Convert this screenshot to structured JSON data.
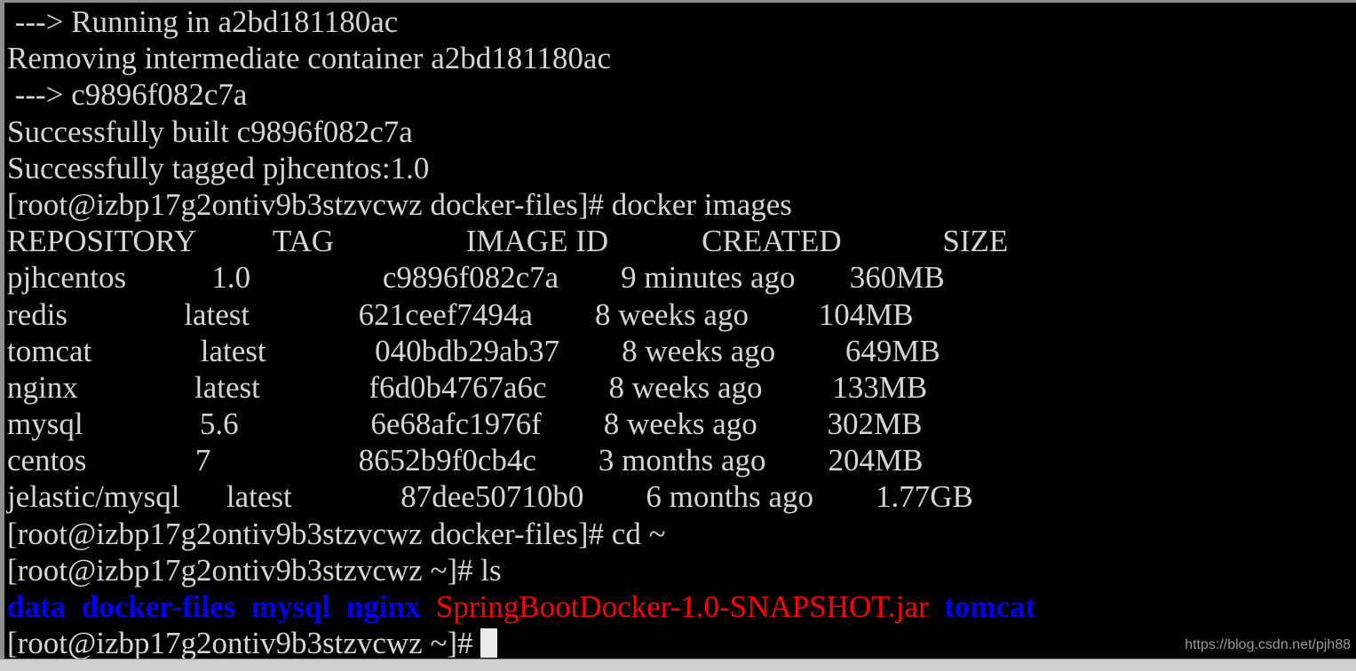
{
  "terminal": {
    "background_color": "#000000",
    "text_color": "#d3d7cf",
    "dir_color": "#0000ee",
    "archive_color": "#ff0000",
    "prompt": "[root@izbp17g2ontiv9b3stzvcwz docker-files]#",
    "prompt_home": "[root@izbp17g2ontiv9b3stzvcwz ~]#",
    "hostname": "izbp17g2ontiv9b3stzvcwz",
    "user": "root",
    "lines": {
      "l1": " ---> Running in a2bd181180ac",
      "l2": "Removing intermediate container a2bd181180ac",
      "l3": " ---> c9896f082c7a",
      "l4": "Successfully built c9896f082c7a",
      "l5": "Successfully tagged pjhcentos:1.0",
      "l6": "[root@izbp17g2ontiv9b3stzvcwz docker-files]# docker images",
      "l7": "REPOSITORY          TAG                 IMAGE ID            CREATED             SIZE",
      "l8": "pjhcentos           1.0                 c9896f082c7a        9 minutes ago       360MB",
      "l9": "redis               latest              621ceef7494a        8 weeks ago         104MB",
      "l10": "tomcat              latest              040bdb29ab37        8 weeks ago         649MB",
      "l11": "nginx               latest              f6d0b4767a6c        8 weeks ago         133MB",
      "l12": "mysql               5.6                 6e68afc1976f        8 weeks ago         302MB",
      "l13": "centos              7                   8652b9f0cb4c        3 months ago        204MB",
      "l14": "jelastic/mysql      latest              87dee50710b0        6 months ago        1.77GB",
      "l15": "[root@izbp17g2ontiv9b3stzvcwz docker-files]# cd ~",
      "l16": "[root@izbp17g2ontiv9b3stzvcwz ~]# ls",
      "l18": "[root@izbp17g2ontiv9b3stzvcwz ~]# "
    },
    "commands": {
      "docker_images": "docker images",
      "cd_home": "cd ~",
      "ls": "ls"
    },
    "table": {
      "headers": [
        "REPOSITORY",
        "TAG",
        "IMAGE ID",
        "CREATED",
        "SIZE"
      ],
      "rows": [
        {
          "repository": "pjhcentos",
          "tag": "1.0",
          "image_id": "c9896f082c7a",
          "created": "9 minutes ago",
          "size": "360MB"
        },
        {
          "repository": "redis",
          "tag": "latest",
          "image_id": "621ceef7494a",
          "created": "8 weeks ago",
          "size": "104MB"
        },
        {
          "repository": "tomcat",
          "tag": "latest",
          "image_id": "040bdb29ab37",
          "created": "8 weeks ago",
          "size": "649MB"
        },
        {
          "repository": "nginx",
          "tag": "latest",
          "image_id": "f6d0b4767a6c",
          "created": "8 weeks ago",
          "size": "133MB"
        },
        {
          "repository": "mysql",
          "tag": "5.6",
          "image_id": "6e68afc1976f",
          "created": "8 weeks ago",
          "size": "302MB"
        },
        {
          "repository": "centos",
          "tag": "7",
          "image_id": "8652b9f0cb4c",
          "created": "3 months ago",
          "size": "204MB"
        },
        {
          "repository": "jelastic/mysql",
          "tag": "latest",
          "image_id": "87dee50710b0",
          "created": "6 months ago",
          "size": "1.77GB"
        }
      ]
    },
    "ls_output": {
      "i0": "data",
      "sp0": "  ",
      "i1": "docker-files",
      "sp1": "  ",
      "i2": "mysql",
      "sp2": "  ",
      "i3": "nginx",
      "sp3": "  ",
      "i4": "SpringBootDocker-1.0-SNAPSHOT.jar",
      "sp4": "  ",
      "i5": "tomcat"
    },
    "build_info": {
      "container_id": "a2bd181180ac",
      "built_image_id": "c9896f082c7a",
      "tagged_image": "pjhcentos:1.0"
    }
  },
  "watermark": {
    "text": "https://blog.csdn.net/pjh88"
  }
}
